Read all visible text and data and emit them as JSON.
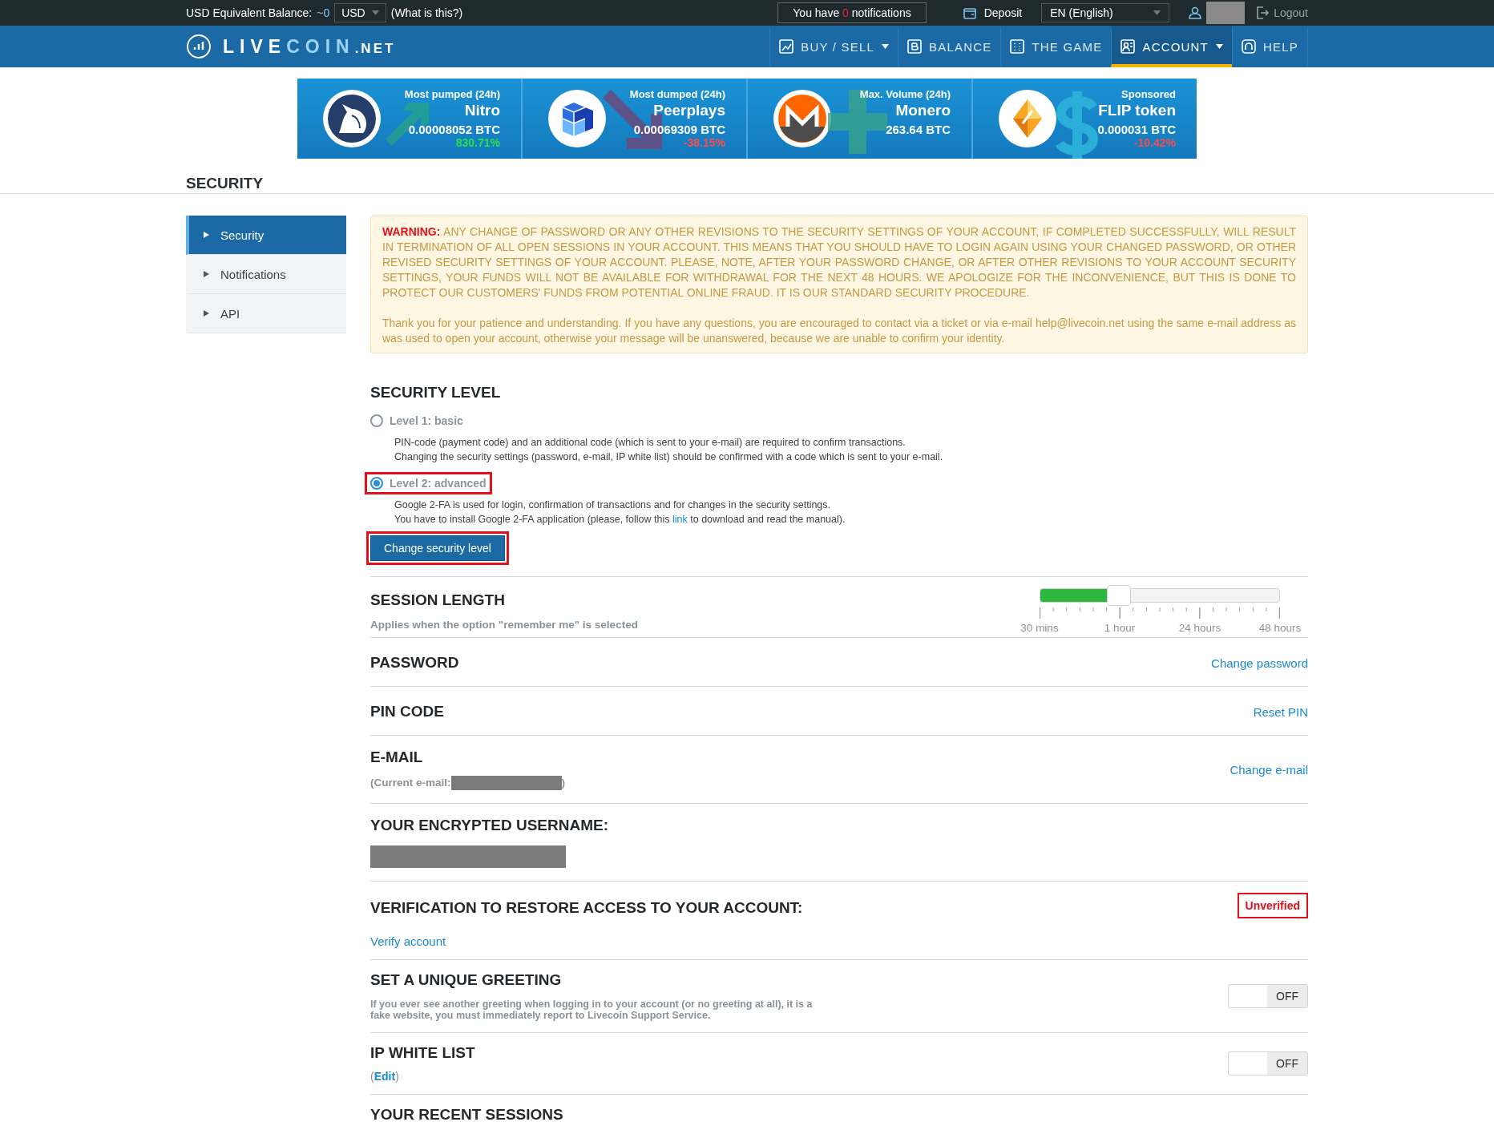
{
  "top_bar": {
    "balance_label": "USD Equivalent Balance:",
    "balance_value": "~0",
    "currency": "USD",
    "help_link": "(What is this?)",
    "notifications": {
      "prefix": "You have",
      "count": "0",
      "suffix": "notifications"
    },
    "deposit": "Deposit",
    "language": "EN (English)",
    "logout": "Logout"
  },
  "nav": {
    "logo_primary": "LIVE",
    "logo_accent": "COIN",
    "logo_suffix": ".NET",
    "items": [
      {
        "label": "BUY / SELL",
        "dropdown": true,
        "selected": false
      },
      {
        "label": "BALANCE",
        "dropdown": false,
        "selected": false
      },
      {
        "label": "THE GAME",
        "dropdown": false,
        "selected": false
      },
      {
        "label": "ACCOUNT",
        "dropdown": true,
        "selected": true
      },
      {
        "label": "HELP",
        "dropdown": false,
        "selected": false
      }
    ]
  },
  "ticker": [
    {
      "label": "Most pumped (24h)",
      "name": "Nitro",
      "price": "0.00008052 BTC",
      "change": "830.71%",
      "kind": "gain"
    },
    {
      "label": "Most dumped (24h)",
      "name": "Peerplays",
      "price": "0.00069309 BTC",
      "change": "-38.15%",
      "kind": "loss"
    },
    {
      "label": "Max. Volume (24h)",
      "name": "Monero",
      "price": "263.64 BTC",
      "kind": "volume"
    },
    {
      "label": "Sponsored",
      "name": "FLIP token",
      "price": "0.000031 BTC",
      "change": "-10.42%",
      "kind": "sponsored"
    }
  ],
  "page_title": "SECURITY",
  "sidebar": [
    {
      "label": "Security",
      "selected": true
    },
    {
      "label": "Notifications",
      "selected": false
    },
    {
      "label": "API",
      "selected": false
    }
  ],
  "warning": {
    "text": "**WARNING:** ANY CHANGE OF PASSWORD OR ANY OTHER REVISIONS TO THE SECURITY SETTINGS OF YOUR ACCOUNT, IF COMPLETED SUCCESSFULLY, WILL RESULT IN TERMINATION OF ALL OPEN SESSIONS IN YOUR ACCOUNT. THIS MEANS THAT YOU SHOULD HAVE TO LOGIN AGAIN USING YOUR CHANGED PASSWORD, OR OTHER REVISED SECURITY SETTINGS OF YOUR ACCOUNT. PLEASE, NOTE, AFTER YOUR PASSWORD CHANGE, OR AFTER OTHER REVISIONS TO YOUR ACCOUNT SECURITY SETTINGS, YOUR FUNDS WILL NOT BE AVAILABLE FOR WITHDRAWAL FOR THE NEXT 48 HOURS. WE APOLOGIZE FOR THE INCONVENIENCE, BUT THIS IS DONE TO PROTECT OUR CUSTOMERS' FUNDS FROM POTENTIAL ONLINE FRAUD. IT IS OUR STANDARD SECURITY PROCEDURE.",
    "note": "Thank you for your patience and understanding. If you have any questions, you are encouraged to contact via a ticket or via e-mail help@livecoin.net using the same e-mail address as was used to open your account, otherwise your message will be unanswered, because we are unable to confirm your identity."
  },
  "sections": [
    {
      "kind": "security_level",
      "title": "SECURITY LEVEL",
      "options": [
        {
          "label": "Level 1: basic",
          "selected": false,
          "highlighted": false,
          "lines": [
            {
              "text": "PIN-code (payment code) and an additional code (which is sent to your e-mail) are required to confirm transactions."
            },
            {
              "text": "Changing the security settings (password, e-mail, IP white list) should be confirmed with a code which is sent to your e-mail."
            }
          ]
        },
        {
          "label": "Level 2: advanced",
          "selected": true,
          "highlighted": true,
          "lines": [
            {
              "text": "Google 2-FA is used for login, confirmation of transactions and for changes in the security settings."
            },
            {
              "text": "You have to install Google 2-FA application (please, follow this",
              "link": "link",
              "after": "to download and read the manual)."
            }
          ]
        }
      ],
      "button": {
        "label": "Change security level",
        "highlighted": true
      }
    },
    {
      "kind": "slider",
      "title": "SESSION LENGTH",
      "subtitle": "Applies when the option \"remember me\" is selected",
      "level": 0.33,
      "ticks": [
        "30 mins",
        "1 hour",
        "24 hours",
        "48 hours"
      ]
    },
    {
      "kind": "action",
      "title": "PASSWORD",
      "action": "Change password"
    },
    {
      "kind": "action",
      "title": "PIN CODE",
      "action": "Reset PIN"
    },
    {
      "kind": "email",
      "title": "E-MAIL",
      "before": "(Current e-mail:",
      "after": ")",
      "action": "Change e-mail"
    },
    {
      "kind": "username",
      "title": "YOUR ENCRYPTED USERNAME:"
    },
    {
      "kind": "verification",
      "title": "VERIFICATION TO RESTORE ACCESS TO YOUR ACCOUNT:",
      "status": "Unverified",
      "link": "Verify account"
    },
    {
      "kind": "toggle",
      "title": "SET A UNIQUE GREETING",
      "description": "If you ever see another greeting when logging in to your account (or no greeting at all), it is a fake website, you must immediately report to Livecoin Support Service.",
      "toggle_label": "OFF",
      "on": false
    },
    {
      "kind": "toggle",
      "title": "IP WHITE LIST",
      "before": "(",
      "link": "Edit",
      "after": ")",
      "toggle_label": "OFF",
      "on": false
    },
    {
      "kind": "heading",
      "title": "YOUR RECENT SESSIONS"
    }
  ]
}
